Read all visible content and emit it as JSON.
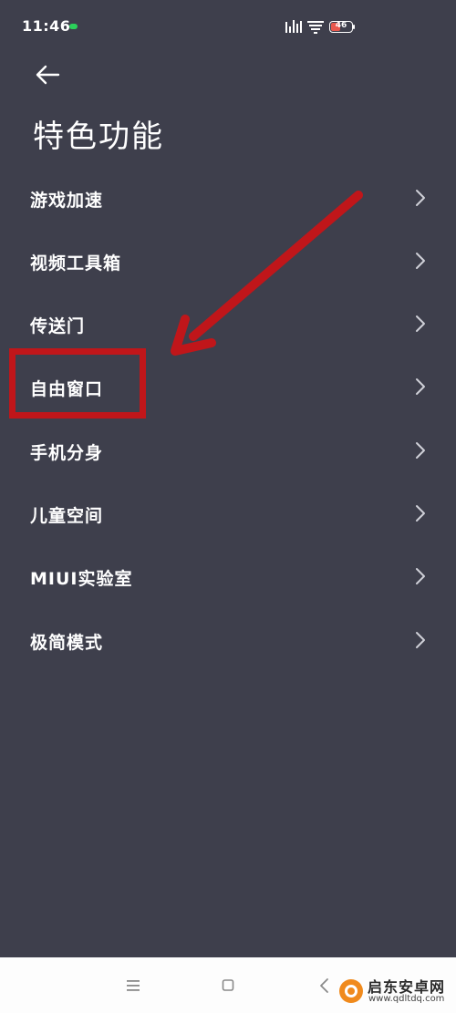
{
  "status_bar": {
    "time": "11:46",
    "battery_level": "46",
    "battery_percent": 46,
    "battery_color": "#e8584d",
    "chat_dot_color": "#2bd05a"
  },
  "header": {
    "back_icon": "arrow-left-icon",
    "title": "特色功能"
  },
  "menu": {
    "items": [
      {
        "label": "游戏加速"
      },
      {
        "label": "视频工具箱"
      },
      {
        "label": "传送门"
      },
      {
        "label": "自由窗口"
      },
      {
        "label": "手机分身"
      },
      {
        "label": "儿童空间"
      },
      {
        "label": "MIUI实验室"
      },
      {
        "label": "极简模式"
      }
    ],
    "chevron_icon": "chevron-right-icon"
  },
  "annotation": {
    "color": "#c0161a",
    "highlighted_item": "自由窗口"
  },
  "nav_bar": {
    "icons": [
      "menu-icon",
      "home-icon",
      "back-icon"
    ]
  },
  "watermark": {
    "name": "启东安卓网",
    "url": "www.qdltdq.com"
  },
  "colors": {
    "background": "#3e3f4c",
    "text": "#ffffff",
    "nav_background": "#fdfdfd"
  }
}
